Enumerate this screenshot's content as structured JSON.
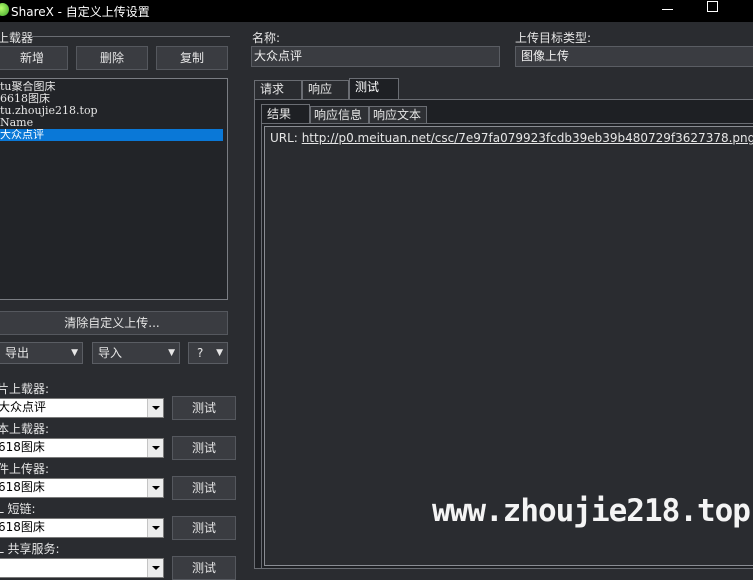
{
  "window": {
    "title": "ShareX - 自定义上传设置",
    "minimize_icon": "minimize-icon",
    "maximize_icon": "maximize-icon"
  },
  "uploaders_panel": {
    "group_label": "上载器",
    "buttons": {
      "add": "新增",
      "delete": "删除",
      "copy": "复制"
    },
    "list_items": [
      {
        "label": "tu聚合图床",
        "selected": false
      },
      {
        "label": "6618图床",
        "selected": false
      },
      {
        "label": "tu.zhoujie218.top",
        "selected": false
      },
      {
        "label": "Name",
        "selected": false
      },
      {
        "label": "大众点评",
        "selected": true
      }
    ],
    "clear_button": "清除自定义上传...",
    "export_label": "导出",
    "import_label": "导入",
    "help_label": "?"
  },
  "destinations": [
    {
      "label": "片上载器:",
      "value": "大众点评",
      "test": "测试"
    },
    {
      "label": "本上载器:",
      "value": "618图床",
      "test": "测试"
    },
    {
      "label": "件上传器:",
      "value": "618图床",
      "test": "测试"
    },
    {
      "label": "L 短链:",
      "value": "618图床",
      "test": "测试"
    },
    {
      "label": "L 共享服务:",
      "value": "",
      "test": "测试"
    }
  ],
  "config": {
    "name_label": "名称:",
    "name_value": "大众点评",
    "dest_type_label": "上传目标类型:",
    "dest_type_value": "图像上传"
  },
  "tabs": {
    "request": "请求",
    "response": "响应",
    "test": "测试",
    "active": "测试"
  },
  "test_tabs": {
    "result": "结果",
    "response_info": "响应信息",
    "response_text": "响应文本",
    "active": "结果"
  },
  "result": {
    "url_label": "URL:",
    "url": "http://p0.meituan.net/csc/7e97fa079923fcdb39eb39b480729f3627378.png"
  },
  "watermark": "www.zhoujie218.top",
  "colors": {
    "background": "#2a2c30",
    "titlebar": "#000000",
    "selection": "#0a78d7"
  }
}
